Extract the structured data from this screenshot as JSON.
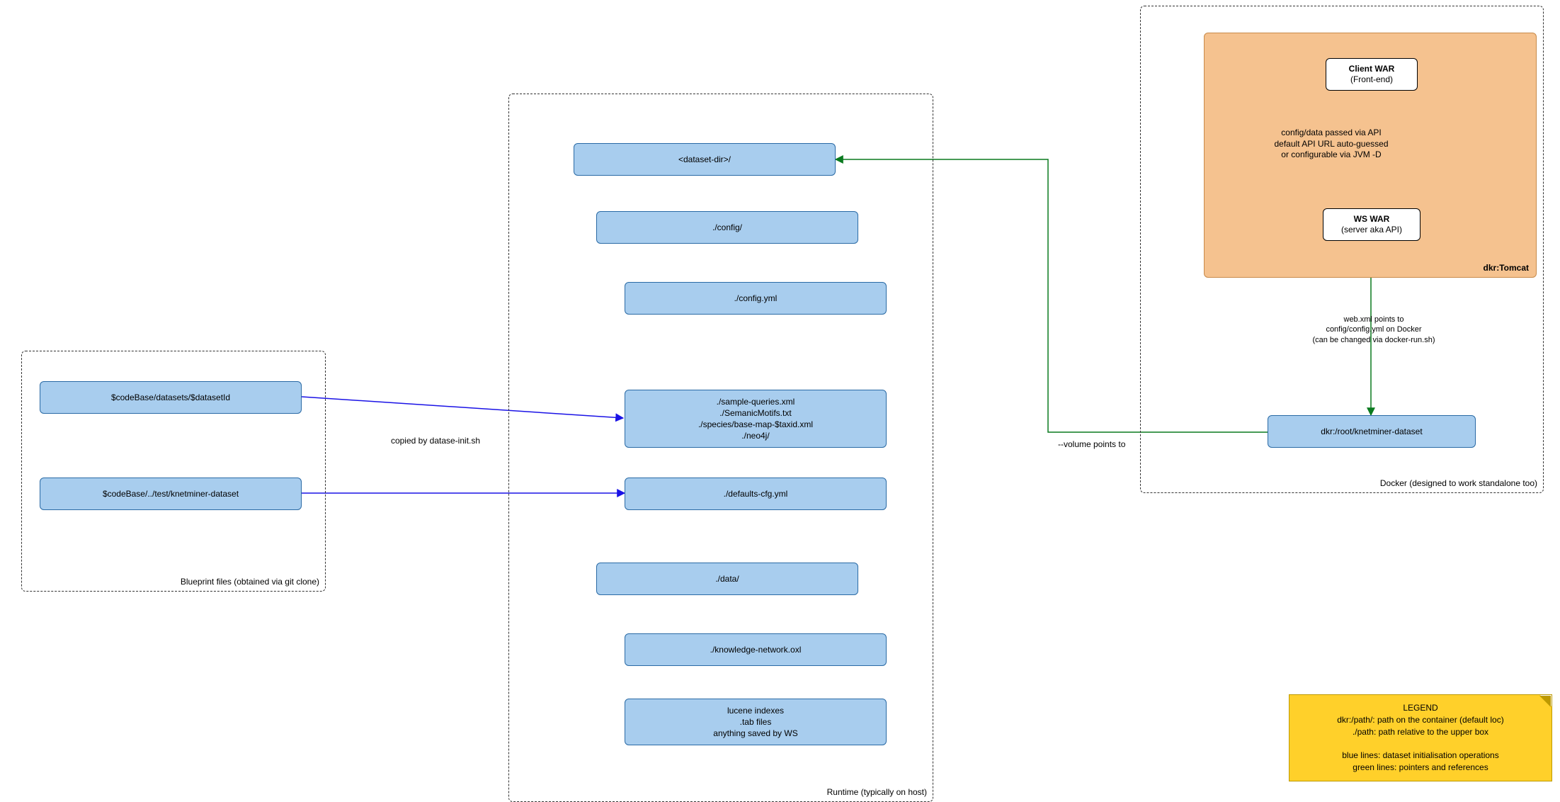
{
  "groups": {
    "blueprint": "Blueprint files (obtained via git clone)",
    "runtime": "Runtime (typically on host)",
    "docker": "Docker (designed to work standalone too)",
    "tomcat": "dkr:Tomcat"
  },
  "blueprint": {
    "datasets": "$codeBase/datasets/$datasetId",
    "test": "$codeBase/../test/knetminer-dataset"
  },
  "runtime": {
    "datasetDir": "<dataset-dir>/",
    "config": "./config/",
    "configYml": "./config.yml",
    "samples": "./sample-queries.xml\n./SemanicMotifs.txt\n./species/base-map-$taxid.xml\n./neo4j/",
    "defaultsCfg": "./defaults-cfg.yml",
    "data": "./data/",
    "oxl": "./knowledge-network.oxl",
    "lucene": "lucene indexes\n.tab files\nanything saved by WS"
  },
  "docker": {
    "clientWar": {
      "title": "Client WAR",
      "subtitle": "(Front-end)"
    },
    "wsWar": {
      "title": "WS WAR",
      "subtitle": "(server aka API)"
    },
    "rootDataset": "dkr:/root/knetminer-dataset"
  },
  "edges": {
    "copiedBy": "copied by datase-init.sh",
    "apiNote": "config/data passed via API\ndefault API URL auto-guessed\nor configurable via JVM -D",
    "webxml": "web.xml points to\nconfig/config.yml on Docker\n(can be changed via docker-run.sh)",
    "volume": "--volume points to"
  },
  "legend": "LEGEND\ndkr:/path/:  path on the container (default loc)\n./path: path relative to the upper box\n\nblue lines: dataset initialisation operations\ngreen lines: pointers and references"
}
